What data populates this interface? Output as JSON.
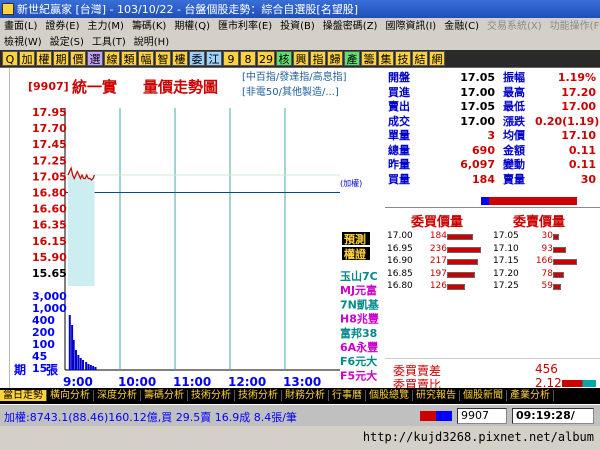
{
  "titlebar": {
    "title": "新世紀贏家 [台灣] - 103/10/22 - 台盤個股走勢：綜合自選股[名望股]"
  },
  "menubar": {
    "items": [
      "畫面(L)",
      "證券(E)",
      "主力(M)",
      "籌碼(K)",
      "期權(Q)",
      "匯市利率(E)",
      "投資(B)",
      "操盤密碼(Z)",
      "國際資訊(I)",
      "金融(C)",
      "交易系統(X)",
      "功能操作(F)"
    ],
    "dim": [
      false,
      false,
      false,
      false,
      false,
      false,
      false,
      false,
      false,
      false,
      true,
      true
    ]
  },
  "menubar2": {
    "items": [
      "檢視(W)",
      "設定(S)",
      "工具(T)",
      "說明(H)"
    ]
  },
  "toolbar": {
    "buttons": [
      {
        "label": "Q",
        "bg": "#ffd23f",
        "fg": "#000"
      },
      {
        "label": "加",
        "bg": "#ffd23f",
        "fg": "#000"
      },
      {
        "label": "權",
        "bg": "#ffd23f",
        "fg": "#000"
      },
      {
        "label": "期",
        "bg": "#ffd23f",
        "fg": "#000"
      },
      {
        "label": "價",
        "bg": "#ffd23f",
        "fg": "#000"
      },
      {
        "label": "選",
        "bg": "#c3a3ff",
        "fg": "#000"
      },
      {
        "label": "線",
        "bg": "#ffd23f",
        "fg": "#000"
      },
      {
        "label": "類",
        "bg": "#ffd23f",
        "fg": "#000"
      },
      {
        "label": "幅",
        "bg": "#ffd23f",
        "fg": "#000"
      },
      {
        "label": "智",
        "bg": "#ffd23f",
        "fg": "#000"
      },
      {
        "label": "樓",
        "bg": "#ffd23f",
        "fg": "#000"
      },
      {
        "label": "委",
        "bg": "#9bd4ff",
        "fg": "#000"
      },
      {
        "label": "江",
        "bg": "#9bd4ff",
        "fg": "#000"
      },
      {
        "label": "9",
        "bg": "#ffd23f",
        "fg": "#000"
      },
      {
        "label": "8",
        "bg": "#ffd23f",
        "fg": "#000"
      },
      {
        "label": "29",
        "bg": "#ffd23f",
        "fg": "#000"
      },
      {
        "label": "核",
        "bg": "#5fe06f",
        "fg": "#000"
      },
      {
        "label": "興",
        "bg": "#ffd23f",
        "fg": "#000"
      },
      {
        "label": "指",
        "bg": "#ffd23f",
        "fg": "#000"
      },
      {
        "label": "歸",
        "bg": "#ffd23f",
        "fg": "#000"
      },
      {
        "label": "產",
        "bg": "#5fe06f",
        "fg": "#000"
      },
      {
        "label": "籌",
        "bg": "#ffd23f",
        "fg": "#000"
      },
      {
        "label": "集",
        "bg": "#ffd23f",
        "fg": "#000"
      },
      {
        "label": "技",
        "bg": "#ffd23f",
        "fg": "#000"
      },
      {
        "label": "結",
        "bg": "#ffd23f",
        "fg": "#000"
      },
      {
        "label": "網",
        "bg": "#ffd23f",
        "fg": "#000"
      }
    ]
  },
  "stock": {
    "code": "[9907]",
    "name": "統一實",
    "chart_title": "量價走勢圖",
    "cat1": "[中百指/發達指/高息指]",
    "cat2": "[非電50/其他製造/...]"
  },
  "chart_data": {
    "type": "line",
    "ylabels_price": [
      "17.95",
      "17.70",
      "17.45",
      "17.25",
      "17.05",
      "16.80",
      "16.60",
      "16.35",
      "16.15",
      "15.90",
      "15.65"
    ],
    "ylabels_vol": [
      "3,000",
      "1,000",
      "400",
      "200",
      "100",
      "45",
      "15"
    ],
    "xlabels": [
      "9:00",
      "10:00",
      "11:00",
      "12:00",
      "13:00"
    ],
    "ylim": [
      15.65,
      17.95
    ],
    "ref_price": 16.8,
    "price_line": [
      [
        0,
        17.05
      ],
      [
        2,
        17.1
      ],
      [
        4,
        17.15
      ],
      [
        6,
        17.05
      ],
      [
        8,
        17.0
      ],
      [
        10,
        17.05
      ],
      [
        12,
        17.1
      ],
      [
        14,
        17.05
      ],
      [
        16,
        17.0
      ],
      [
        18,
        17.05
      ],
      [
        20,
        17.0
      ],
      [
        22,
        17.0
      ],
      [
        24,
        17.05
      ],
      [
        26,
        17.0
      ],
      [
        28,
        17.0
      ],
      [
        30,
        16.98
      ],
      [
        32,
        17.0
      ],
      [
        34,
        17.05
      ]
    ],
    "vol_bars": [
      [
        1,
        55
      ],
      [
        4,
        45
      ],
      [
        6,
        30
      ],
      [
        9,
        20
      ],
      [
        12,
        15
      ],
      [
        15,
        12
      ],
      [
        18,
        10
      ],
      [
        22,
        8
      ],
      [
        25,
        6
      ],
      [
        28,
        5
      ],
      [
        31,
        4
      ],
      [
        34,
        3
      ]
    ],
    "left_label_top": "期",
    "left_label_bot": "張",
    "ratio_note": "(加權)",
    "badges": [
      "預測",
      "權證"
    ],
    "warrants": [
      "玉山7C",
      "MJ元富",
      "7N凱基",
      "H8兆豐",
      "富邦38",
      "6A永豐",
      "F6元大",
      "F5元大"
    ]
  },
  "quote": {
    "rows": [
      {
        "l1": "開盤",
        "v1": "17.05",
        "c1": "#000",
        "l2": "振幅",
        "v2": "1.19%",
        "c2": "#c00"
      },
      {
        "l1": "買進",
        "v1": "17.00",
        "c1": "#000",
        "l2": "最高",
        "v2": "17.20",
        "c2": "#c00"
      },
      {
        "l1": "賣出",
        "v1": "17.05",
        "c1": "#000",
        "l2": "最低",
        "v2": "17.00",
        "c2": "#c00"
      },
      {
        "l1": "成交",
        "v1": "17.00",
        "c1": "#000",
        "l2": "漲跌",
        "v2": "0.20(1.19)",
        "c2": "#c00"
      },
      {
        "l1": "單量",
        "v1": "3",
        "c1": "#c00",
        "l2": "均價",
        "v2": "17.10",
        "c2": "#c00"
      },
      {
        "l1": "總量",
        "v1": "690",
        "c1": "#c00",
        "l2": "金額",
        "v2": "0.11",
        "c2": "#c00"
      },
      {
        "l1": "昨量",
        "v1": "6,097",
        "c1": "#c00",
        "l2": "變動",
        "v2": "0.11",
        "c2": "#c00"
      },
      {
        "l1": "買量",
        "v1": "184",
        "c1": "#c00",
        "l2": "賣量",
        "v2": "30",
        "c2": "#c00"
      }
    ]
  },
  "depth": {
    "bid_title": "委買價量",
    "ask_title": "委賣價量",
    "bids": [
      [
        "17.00",
        "184"
      ],
      [
        "16.95",
        "236"
      ],
      [
        "16.90",
        "217"
      ],
      [
        "16.85",
        "197"
      ],
      [
        "16.80",
        "126"
      ]
    ],
    "asks": [
      [
        "17.05",
        "30"
      ],
      [
        "17.10",
        "93"
      ],
      [
        "17.15",
        "166"
      ],
      [
        "17.20",
        "78"
      ],
      [
        "17.25",
        "59"
      ]
    ]
  },
  "spread": {
    "l1": "委買賣差",
    "v1": "456",
    "l2": "委買賣比",
    "v2": "2.12"
  },
  "tabs": [
    "當日走勢",
    "橫向分析",
    "深度分析",
    "籌碼分析",
    "技術分析",
    "技術分析",
    "財務分析",
    "行事曆",
    "個股總覽",
    "研究報告",
    "個股新聞",
    "產業分析"
  ],
  "status": {
    "ticker": "加權:8743.1(88.46)160.12億,買 29.5賣 16.9成 8.4張/筆",
    "code": "9907",
    "time": "09:19:28/"
  },
  "watermark": "http://kujd3268.pixnet.net/album"
}
